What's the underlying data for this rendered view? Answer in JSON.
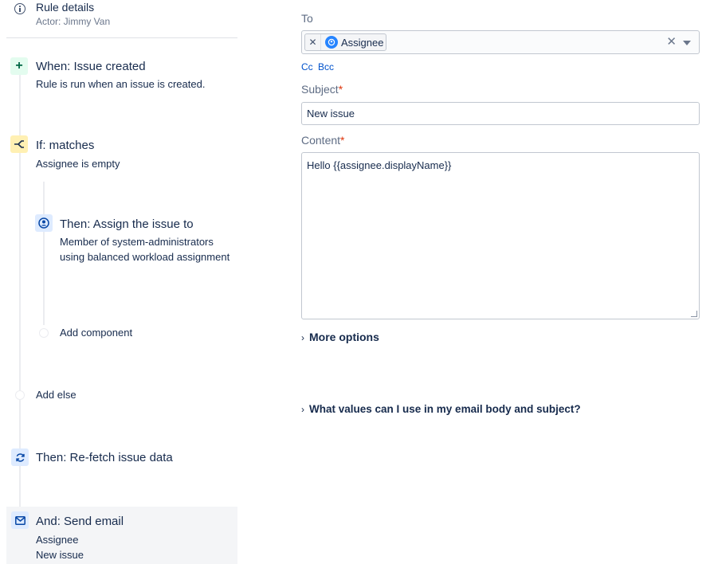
{
  "rule_details": {
    "title": "Rule details",
    "actor": "Actor: Jimmy Van"
  },
  "components": {
    "when": {
      "title": "When: Issue created",
      "description": "Rule is run when an issue is created."
    },
    "if": {
      "title": "If: matches",
      "description": "Assignee is empty"
    },
    "then_assign": {
      "title": "Then: Assign the issue to",
      "description": "Member of system-administrators using balanced workload assignment"
    },
    "add_component": "Add component",
    "add_else": "Add else",
    "then_refetch": {
      "title": "Then: Re-fetch issue data"
    },
    "send_email": {
      "title": "And: Send email",
      "line1": "Assignee",
      "line2": "New issue"
    }
  },
  "email_form": {
    "to_label": "To",
    "to_chip": "Assignee",
    "cc_label": "Cc",
    "bcc_label": "Bcc",
    "subject_label": "Subject",
    "subject_value": "New issue",
    "content_label": "Content",
    "content_value": "Hello {{assignee.displayName}}",
    "required_marker": "*",
    "more_options": "More options",
    "help_link": "What values can I use in my email body and subject?"
  },
  "icons": {
    "info": "info-icon",
    "trigger": "plus-icon",
    "condition": "branch-icon",
    "assign": "user-icon",
    "refetch": "refresh-icon",
    "email": "envelope-icon"
  },
  "colors": {
    "trigger_bg": "#e3fcef",
    "condition_bg": "#fff0b3",
    "action_bg": "#deebff",
    "link": "#0052cc",
    "required": "#de350b"
  }
}
